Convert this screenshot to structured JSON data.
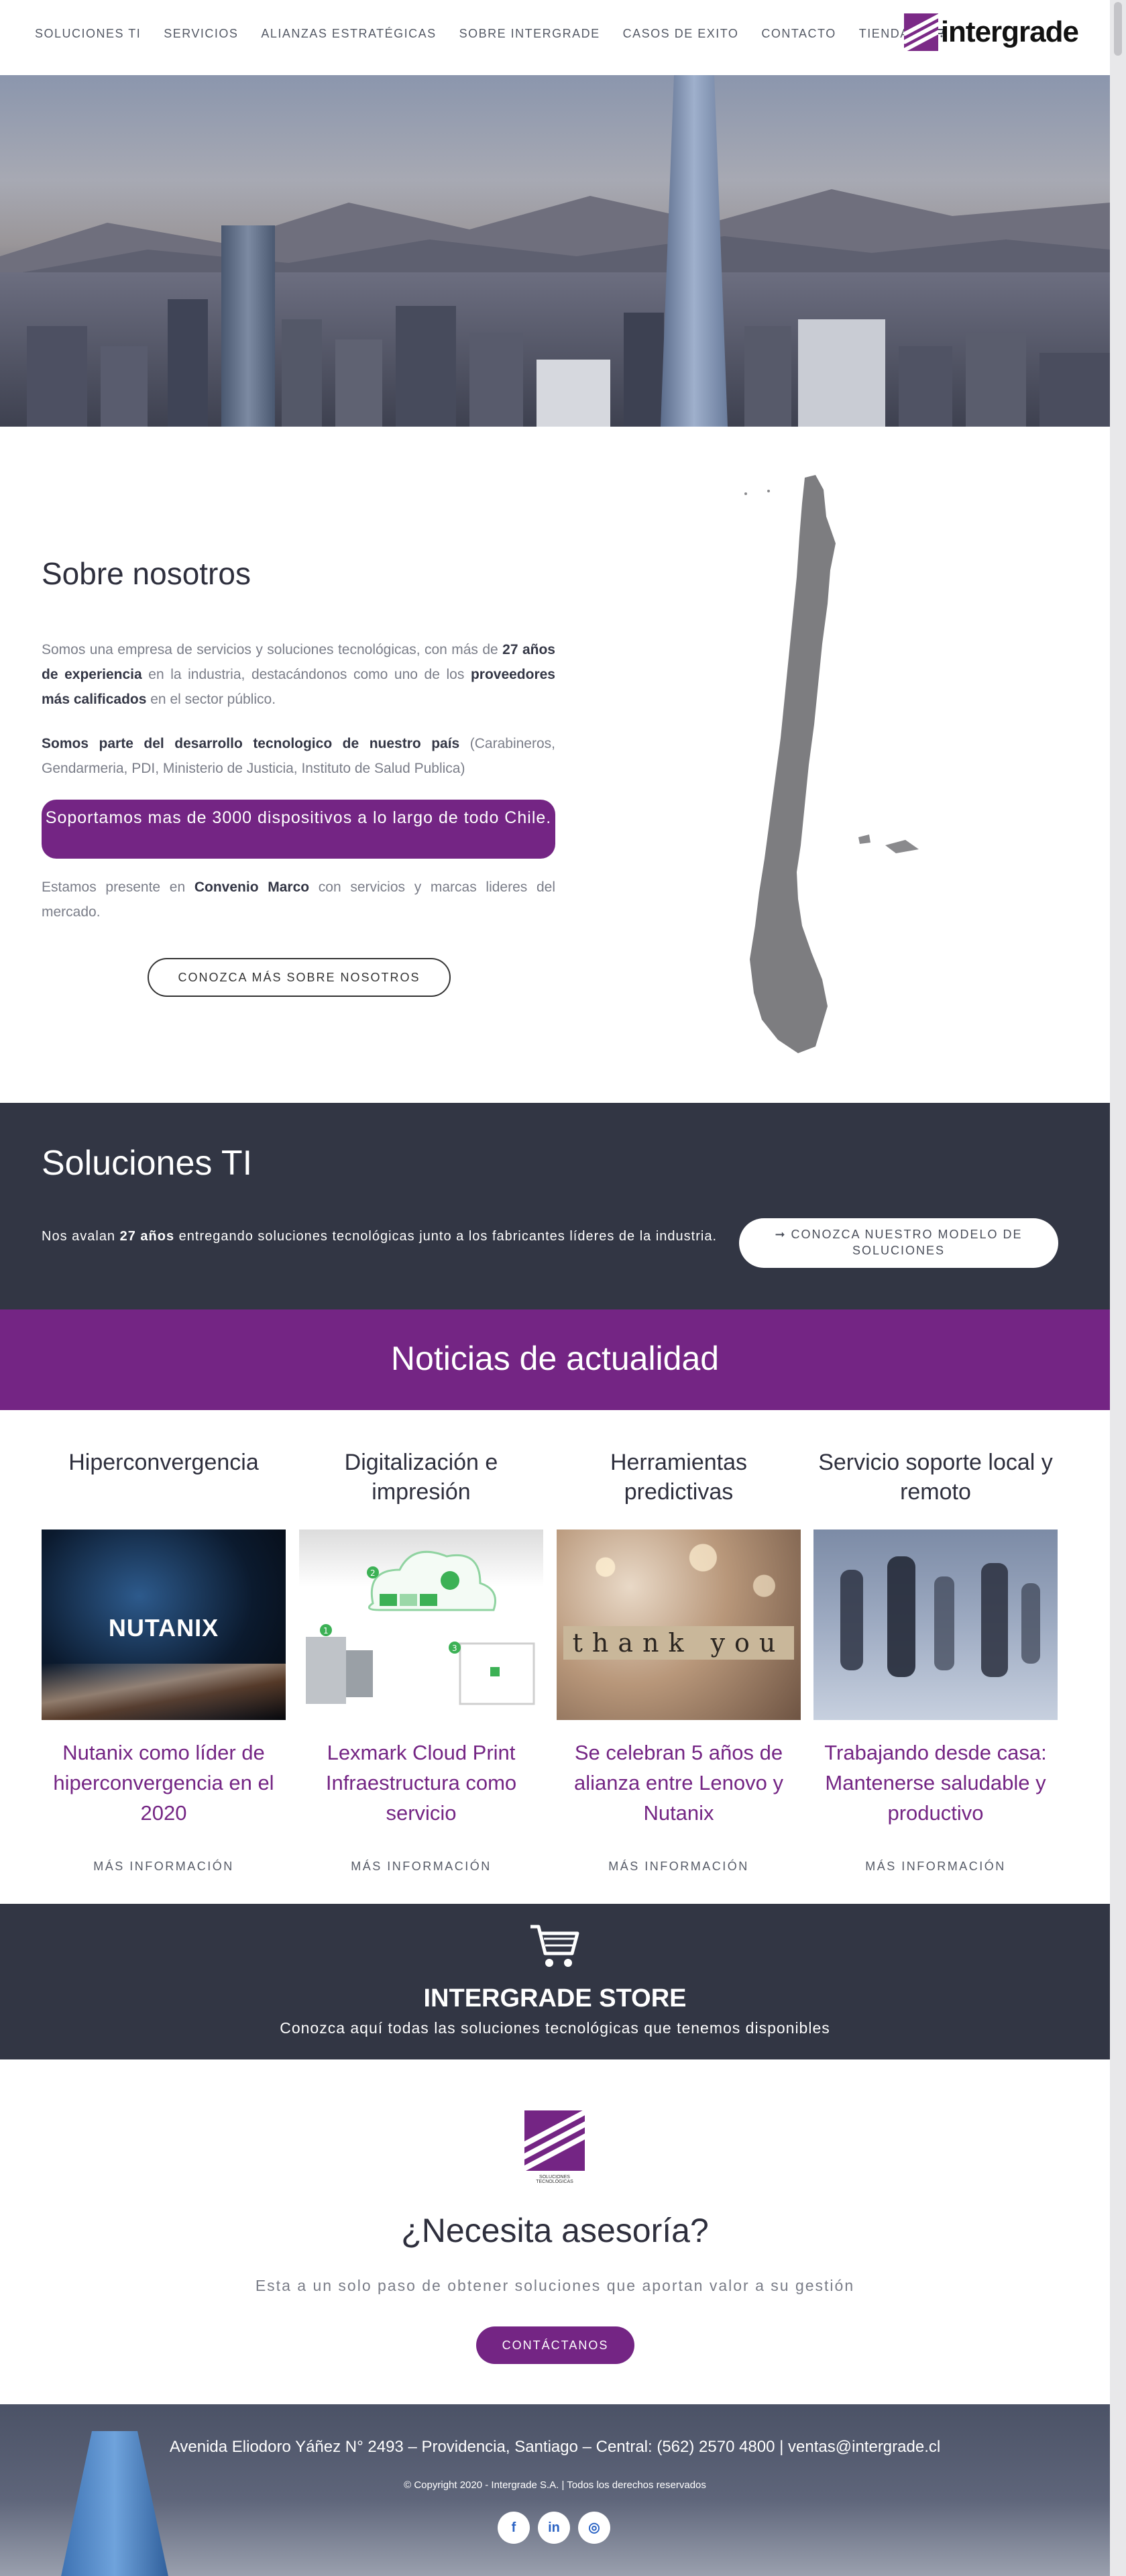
{
  "nav": {
    "items": [
      "SOLUCIONES TI",
      "SERVICIOS",
      "ALIANZAS ESTRATÉGICAS",
      "SOBRE INTERGRADE",
      "CASOS DE EXITO",
      "CONTACTO",
      "TIENDA"
    ],
    "cart_icon": "cart-icon"
  },
  "brand": {
    "name": "intergrade",
    "color": "#742584"
  },
  "about": {
    "title": "Sobre nosotros",
    "p1_a": "Somos una empresa de servicios y soluciones tecnológicas, con más de ",
    "p1_b": "27 años de experiencia",
    "p1_c": " en la industria, destacándonos como uno de los ",
    "p1_d": "proveedores más calificados",
    "p1_e": " en el sector público.",
    "p2_a": "Somos parte del desarrollo tecnologico de nuestro país",
    "p2_b": " (Carabineros, Gendarmeria, PDI, Ministerio de Justicia, Instituto de Salud Publica)",
    "highlight": "Soportamos mas de 3000 dispositivos a lo largo de todo Chile.",
    "p3_a": "Estamos presente en ",
    "p3_b": "Convenio Marco",
    "p3_c": " con servicios y marcas lideres del mercado.",
    "button": "CONOZCA MÁS SOBRE NOSOTROS"
  },
  "soluciones": {
    "title": "Soluciones TI",
    "text_a": "Nos avalan ",
    "text_b": "27 años",
    "text_c": " entregando soluciones tecnológicas junto a los fabricantes líderes de la industria.",
    "button_icon": "arrow-right-icon",
    "button": "CONOZCA NUESTRO MODELO DE SOLUCIONES"
  },
  "news": {
    "title": "Noticias de actualidad",
    "columns": [
      {
        "category": "Hiperconvergencia",
        "headline": "Nutanix como líder de hiperconvergencia en el 2020",
        "more": "MÁS INFORMACIÓN",
        "image_text": "NUTANIX"
      },
      {
        "category": "Digitalización e impresión",
        "headline": "Lexmark Cloud Print Infraestructura como servicio",
        "more": "MÁS INFORMACIÓN",
        "image_text": ""
      },
      {
        "category": "Herramientas predictivas",
        "headline": "Se celebran 5 años de alianza entre Lenovo y Nutanix",
        "more": "MÁS INFORMACIÓN",
        "image_text": "thank you"
      },
      {
        "category": "Servicio soporte local y remoto",
        "headline": "Trabajando desde casa: Mantenerse saludable y productivo",
        "more": "MÁS INFORMACIÓN",
        "image_text": ""
      }
    ]
  },
  "store": {
    "title": "INTERGRADE STORE",
    "subtitle": "Conozca aquí todas las soluciones tecnológicas que tenemos disponibles"
  },
  "asesoria": {
    "logo_caption": "SOLUCIONES TECNOLÓGICAS",
    "title": "¿Necesita asesoría?",
    "subtitle": "Esta a un solo paso de obtener soluciones que aportan valor a su gestión",
    "button": "CONTÁCTANOS"
  },
  "footer": {
    "address": "Avenida Eliodoro Yáñez N° 2493 – Providencia, Santiago – Central: (562) 2570 4800 | ventas@intergrade.cl",
    "copyright": "© Copyright 2020 - Intergrade S.A. | Todos los derechos reservados",
    "socials": [
      {
        "icon": "facebook-icon",
        "glyph": "f"
      },
      {
        "icon": "linkedin-icon",
        "glyph": "in"
      },
      {
        "icon": "instagram-icon",
        "glyph": "◎"
      }
    ]
  }
}
